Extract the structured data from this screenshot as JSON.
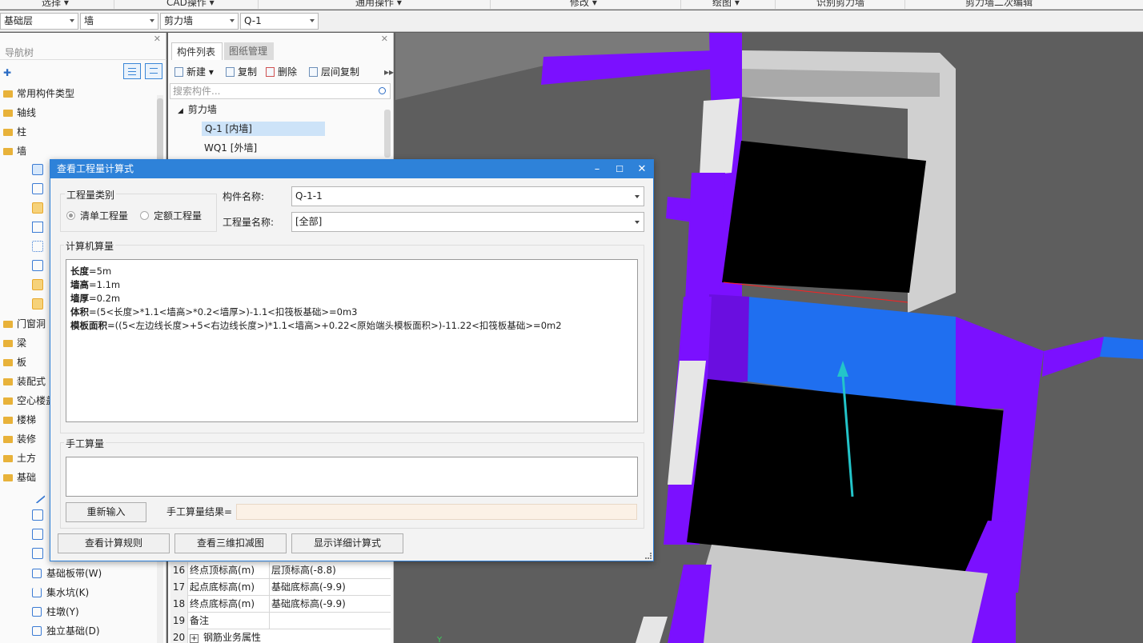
{
  "ribbon": {
    "items": [
      "选择 ▾",
      "CAD操作 ▾",
      "通用操作 ▾",
      "修改 ▾",
      "绘图 ▾",
      "识别剪力墙",
      "剪力墙二次编辑"
    ]
  },
  "selectors": {
    "floor": "基础层",
    "category": "墙",
    "type": "剪力墙",
    "component": "Q-1"
  },
  "nav": {
    "title": "导航树",
    "items": [
      {
        "label": "常用构件类型"
      },
      {
        "label": "轴线"
      },
      {
        "label": "柱"
      },
      {
        "label": "墙"
      },
      {
        "label": "门窗洞"
      },
      {
        "label": "梁"
      },
      {
        "label": "板"
      },
      {
        "label": "装配式"
      },
      {
        "label": "空心楼盖"
      },
      {
        "label": "楼梯"
      },
      {
        "label": "装修"
      },
      {
        "label": "土方"
      },
      {
        "label": "基础"
      }
    ],
    "foundation_children": [
      {
        "label": "基础板带(W)"
      },
      {
        "label": "集水坑(K)"
      },
      {
        "label": "柱墩(Y)"
      },
      {
        "label": "独立基础(D)"
      }
    ]
  },
  "component_panel": {
    "tabs": [
      "构件列表",
      "图纸管理"
    ],
    "tools": [
      "新建 ▾",
      "复制",
      "删除",
      "层间复制"
    ],
    "search_placeholder": "搜索构件...",
    "group": "剪力墙",
    "nodes": [
      "Q-1 [内墙]",
      "WQ1 [外墙]"
    ],
    "properties": [
      {
        "n": "16",
        "key": "终点顶标高(m)",
        "value": "层顶标高(-8.8)"
      },
      {
        "n": "17",
        "key": "起点底标高(m)",
        "value": "基础底标高(-9.9)"
      },
      {
        "n": "18",
        "key": "终点底标高(m)",
        "value": "基础底标高(-9.9)"
      },
      {
        "n": "19",
        "key": "备注",
        "value": ""
      },
      {
        "n": "20",
        "key": "钢筋业务属性",
        "value": ""
      }
    ]
  },
  "dialog": {
    "title": "查看工程量计算式",
    "quantity_type_label": "工程量类别",
    "radio_bill": "清单工程量",
    "radio_quota": "定额工程量",
    "component_name_label": "构件名称:",
    "component_name_value": "Q-1-1",
    "quantity_name_label": "工程量名称:",
    "quantity_name_value": "[全部]",
    "computer_calc_label": "计算机算量",
    "calc_lines": [
      {
        "key": "长度",
        "expr": "=5m"
      },
      {
        "key": "墙高",
        "expr": "=1.1m"
      },
      {
        "key": "墙厚",
        "expr": "=0.2m"
      },
      {
        "key": "体积",
        "expr": "=(5<长度>*1.1<墙高>*0.2<墙厚>)-1.1<扣筏板基础>=0m3"
      },
      {
        "key": "模板面积",
        "expr": "=((5<左边线长度>+5<右边线长度>)*1.1<墙高>+0.22<原始端头模板面积>)-11.22<扣筏板基础>=0m2"
      }
    ],
    "manual_calc_label": "手工算量",
    "reinput_button": "重新输入",
    "manual_result_label": "手工算量结果=",
    "buttons": [
      "查看计算规则",
      "查看三维扣减图",
      "显示详细计算式"
    ]
  },
  "colors": {
    "accent": "#2e82d9",
    "purple_wall": "#7b10ff",
    "blue_wall": "#1f6ff0",
    "arrow_red": "#e83c3c",
    "arrow_cyan": "#23c4c9"
  }
}
